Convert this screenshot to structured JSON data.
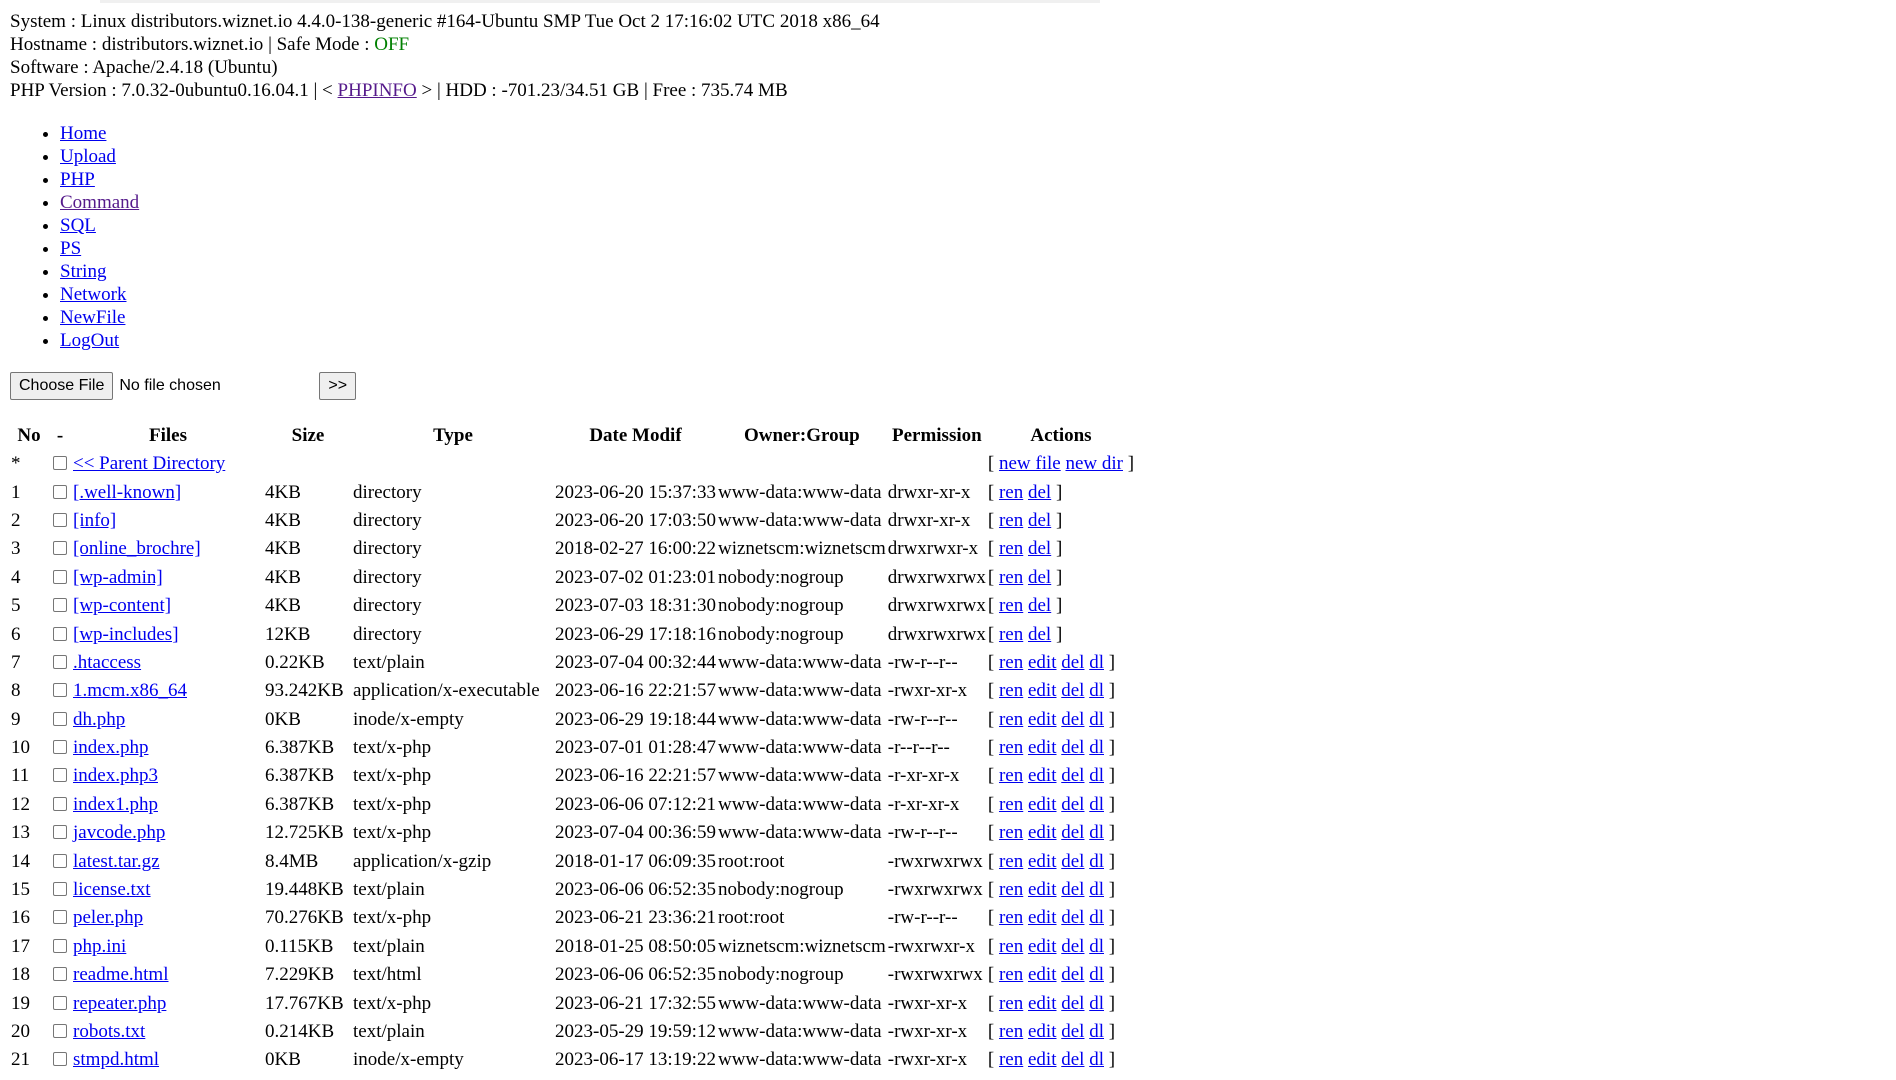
{
  "sysinfo": {
    "system_label": "System : ",
    "system": "Linux distributors.wiznet.io 4.4.0-138-generic #164-Ubuntu SMP Tue Oct 2 17:16:02 UTC 2018 x86_64",
    "hostname_label": "Hostname : ",
    "hostname": "distributors.wiznet.io",
    "safemode_label": " | Safe Mode : ",
    "safemode": "OFF",
    "software_label": "Software : ",
    "software": "Apache/2.4.18 (Ubuntu)",
    "php_label": "PHP Version : ",
    "php": "7.0.32-0ubuntu0.16.04.1",
    "phpinfo_pre": " | < ",
    "phpinfo": "PHPINFO",
    "phpinfo_post": " > | HDD : ",
    "hdd": "-701.23/34.51 GB",
    "free_label": " | Free : ",
    "free": "735.74 MB",
    "colors": {
      "safemode_off": "#008000",
      "link": "#0000ee",
      "visited": "#551a8b"
    }
  },
  "nav": [
    "Home",
    "Upload",
    "PHP",
    "Command",
    "SQL",
    "PS",
    "String",
    "Network",
    "NewFile",
    "LogOut"
  ],
  "upload": {
    "choose": "Choose File",
    "filename": "No file chosen",
    "go": ">>"
  },
  "table": {
    "headers": [
      "No",
      "-",
      "Files",
      "Size",
      "Type",
      "Date Modif",
      "Owner:Group",
      "Permission",
      "Actions"
    ],
    "parent": {
      "no": "*",
      "name": "<< Parent Directory",
      "open": "[ ",
      "new_file": "new file",
      "new_dir": "new dir",
      "close": " ]"
    },
    "actions_labels": {
      "ren": "ren",
      "edit": "edit",
      "del": "del",
      "dl": "dl",
      "open": "[ ",
      "close": " ]"
    },
    "rows": [
      {
        "no": "1",
        "name": "[.well-known]",
        "size": "4KB",
        "type": "directory",
        "date": "2023-06-20 15:37:33",
        "owner": "www-data:www-data",
        "perm": "drwxr-xr-x",
        "dir": true
      },
      {
        "no": "2",
        "name": "[info]",
        "size": "4KB",
        "type": "directory",
        "date": "2023-06-20 17:03:50",
        "owner": "www-data:www-data",
        "perm": "drwxr-xr-x",
        "dir": true
      },
      {
        "no": "3",
        "name": "[online_brochre]",
        "size": "4KB",
        "type": "directory",
        "date": "2018-02-27 16:00:22",
        "owner": "wiznetscm:wiznetscm",
        "perm": "drwxrwxr-x",
        "dir": true
      },
      {
        "no": "4",
        "name": "[wp-admin]",
        "size": "4KB",
        "type": "directory",
        "date": "2023-07-02 01:23:01",
        "owner": "nobody:nogroup",
        "perm": "drwxrwxrwx",
        "dir": true
      },
      {
        "no": "5",
        "name": "[wp-content]",
        "size": "4KB",
        "type": "directory",
        "date": "2023-07-03 18:31:30",
        "owner": "nobody:nogroup",
        "perm": "drwxrwxrwx",
        "dir": true
      },
      {
        "no": "6",
        "name": "[wp-includes]",
        "size": "12KB",
        "type": "directory",
        "date": "2023-06-29 17:18:16",
        "owner": "nobody:nogroup",
        "perm": "drwxrwxrwx",
        "dir": true
      },
      {
        "no": "7",
        "name": ".htaccess",
        "size": "0.22KB",
        "type": "text/plain",
        "date": "2023-07-04 00:32:44",
        "owner": "www-data:www-data",
        "perm": "-rw-r--r--",
        "dir": false
      },
      {
        "no": "8",
        "name": "1.mcm.x86_64",
        "size": "93.242KB",
        "type": "application/x-executable",
        "date": "2023-06-16 22:21:57",
        "owner": "www-data:www-data",
        "perm": "-rwxr-xr-x",
        "dir": false
      },
      {
        "no": "9",
        "name": "dh.php",
        "size": "0KB",
        "type": "inode/x-empty",
        "date": "2023-06-29 19:18:44",
        "owner": "www-data:www-data",
        "perm": "-rw-r--r--",
        "dir": false
      },
      {
        "no": "10",
        "name": "index.php",
        "size": "6.387KB",
        "type": "text/x-php",
        "date": "2023-07-01 01:28:47",
        "owner": "www-data:www-data",
        "perm": "-r--r--r--",
        "dir": false
      },
      {
        "no": "11",
        "name": "index.php3",
        "size": "6.387KB",
        "type": "text/x-php",
        "date": "2023-06-16 22:21:57",
        "owner": "www-data:www-data",
        "perm": "-r-xr-xr-x",
        "dir": false
      },
      {
        "no": "12",
        "name": "index1.php",
        "size": "6.387KB",
        "type": "text/x-php",
        "date": "2023-06-06 07:12:21",
        "owner": "www-data:www-data",
        "perm": "-r-xr-xr-x",
        "dir": false
      },
      {
        "no": "13",
        "name": "javcode.php",
        "size": "12.725KB",
        "type": "text/x-php",
        "date": "2023-07-04 00:36:59",
        "owner": "www-data:www-data",
        "perm": "-rw-r--r--",
        "dir": false
      },
      {
        "no": "14",
        "name": "latest.tar.gz",
        "size": "8.4MB",
        "type": "application/x-gzip",
        "date": "2018-01-17 06:09:35",
        "owner": "root:root",
        "perm": "-rwxrwxrwx",
        "dir": false
      },
      {
        "no": "15",
        "name": "license.txt",
        "size": "19.448KB",
        "type": "text/plain",
        "date": "2023-06-06 06:52:35",
        "owner": "nobody:nogroup",
        "perm": "-rwxrwxrwx",
        "dir": false
      },
      {
        "no": "16",
        "name": "peler.php",
        "size": "70.276KB",
        "type": "text/x-php",
        "date": "2023-06-21 23:36:21",
        "owner": "root:root",
        "perm": "-rw-r--r--",
        "dir": false
      },
      {
        "no": "17",
        "name": "php.ini",
        "size": "0.115KB",
        "type": "text/plain",
        "date": "2018-01-25 08:50:05",
        "owner": "wiznetscm:wiznetscm",
        "perm": "-rwxrwxr-x",
        "dir": false
      },
      {
        "no": "18",
        "name": "readme.html",
        "size": "7.229KB",
        "type": "text/html",
        "date": "2023-06-06 06:52:35",
        "owner": "nobody:nogroup",
        "perm": "-rwxrwxrwx",
        "dir": false
      },
      {
        "no": "19",
        "name": "repeater.php",
        "size": "17.767KB",
        "type": "text/x-php",
        "date": "2023-06-21 17:32:55",
        "owner": "www-data:www-data",
        "perm": "-rwxr-xr-x",
        "dir": false
      },
      {
        "no": "20",
        "name": "robots.txt",
        "size": "0.214KB",
        "type": "text/plain",
        "date": "2023-05-29 19:59:12",
        "owner": "www-data:www-data",
        "perm": "-rwxr-xr-x",
        "dir": false
      },
      {
        "no": "21",
        "name": "stmpd.html",
        "size": "0KB",
        "type": "inode/x-empty",
        "date": "2023-06-17 13:19:22",
        "owner": "www-data:www-data",
        "perm": "-rwxr-xr-x",
        "dir": false
      }
    ]
  }
}
